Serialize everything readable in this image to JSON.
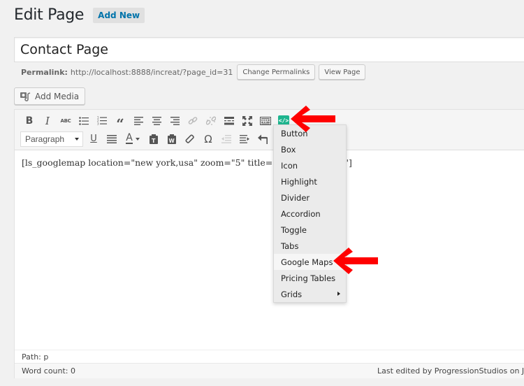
{
  "header": {
    "title": "Edit Page",
    "add_new_label": "Add New"
  },
  "post": {
    "title": "Contact Page",
    "permalink_label": "Permalink:",
    "permalink_url": "http://localhost:8888/increat/?page_id=31",
    "change_permalinks_label": "Change Permalinks",
    "view_page_label": "View Page"
  },
  "media": {
    "add_media_label": "Add Media"
  },
  "toolbar": {
    "row1": [
      {
        "name": "bold",
        "icon": "bold-icon"
      },
      {
        "name": "italic",
        "icon": "italic-icon"
      },
      {
        "name": "strikethrough",
        "icon": "strikethrough-icon"
      },
      {
        "name": "bulleted-list",
        "icon": "bulleted-list-icon"
      },
      {
        "name": "numbered-list",
        "icon": "numbered-list-icon"
      },
      {
        "name": "blockquote",
        "icon": "blockquote-icon"
      },
      {
        "name": "align-left",
        "icon": "align-left-icon"
      },
      {
        "name": "align-center",
        "icon": "align-center-icon"
      },
      {
        "name": "align-right",
        "icon": "align-right-icon"
      },
      {
        "name": "insert-link",
        "icon": "link-icon",
        "disabled": true
      },
      {
        "name": "remove-link",
        "icon": "unlink-icon",
        "disabled": true
      },
      {
        "name": "read-more",
        "icon": "read-more-icon"
      },
      {
        "name": "fullscreen",
        "icon": "fullscreen-icon"
      },
      {
        "name": "toolbar-toggle",
        "icon": "keyboard-icon"
      },
      {
        "name": "shortcodes",
        "icon": "shortcode-icon"
      }
    ],
    "format_select_value": "Paragraph",
    "row2": [
      {
        "name": "underline",
        "icon": "underline-icon"
      },
      {
        "name": "justify",
        "icon": "justify-icon"
      },
      {
        "name": "text-color",
        "icon": "text-color-icon"
      },
      {
        "name": "paste-as-text",
        "icon": "paste-text-icon"
      },
      {
        "name": "paste-from-word",
        "icon": "paste-word-icon"
      },
      {
        "name": "clear-formatting",
        "icon": "eraser-icon"
      },
      {
        "name": "special-character",
        "icon": "omega-icon"
      },
      {
        "name": "outdent",
        "icon": "outdent-icon",
        "disabled": true
      },
      {
        "name": "indent",
        "icon": "indent-icon"
      },
      {
        "name": "undo",
        "icon": "undo-icon"
      }
    ],
    "shortcode_color": "#1fb58f"
  },
  "content": {
    "text": "[ls_googlemap location=\"new york,usa\" zoom=\"5\" title=\"New York, USA\"]"
  },
  "shortcode_menu": {
    "items": [
      {
        "label": "Button"
      },
      {
        "label": "Box"
      },
      {
        "label": "Icon"
      },
      {
        "label": "Highlight"
      },
      {
        "label": "Divider"
      },
      {
        "label": "Accordion"
      },
      {
        "label": "Toggle"
      },
      {
        "label": "Tabs"
      },
      {
        "label": "Google Maps",
        "highlighted": true
      },
      {
        "label": "Pricing Tables"
      },
      {
        "label": "Grids",
        "has_submenu": true
      }
    ]
  },
  "footer": {
    "path": "Path: p",
    "word_count": "Word count: 0",
    "last_edited": "Last edited by ProgressionStudios on Janu"
  },
  "annotations": {
    "arrow_color": "#ff0000"
  }
}
